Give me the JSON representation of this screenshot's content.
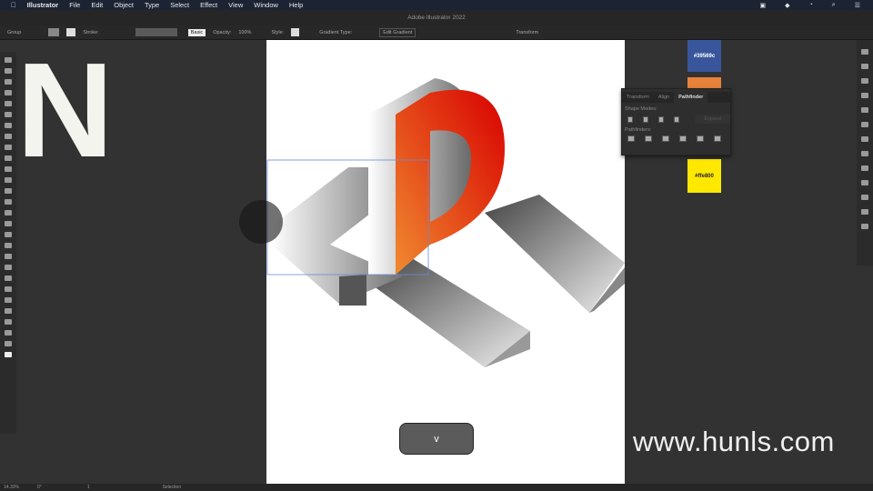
{
  "menubar": {
    "app": "Illustrator",
    "items": [
      "File",
      "Edit",
      "Object",
      "Type",
      "Select",
      "Effect",
      "View",
      "Window",
      "Help"
    ]
  },
  "window_title": "Adobe Illustrator 2022",
  "control": {
    "selection": "Group",
    "stroke_label": "Stroke:",
    "brush": "Basic",
    "opacity_label": "Opacity:",
    "opacity": "100%",
    "style_label": "Style:",
    "gradient_type_label": "Gradient Type:",
    "edit_gradient": "Edit Gradient",
    "transform": "Transform"
  },
  "swatches": [
    {
      "label": "#39569c",
      "color": "#39569c"
    },
    {
      "label": "",
      "color": "#e8823a"
    },
    {
      "label": "#ffe800",
      "color": "#ffe800"
    }
  ],
  "pathfinder": {
    "tabs": [
      "Transform",
      "Align",
      "Pathfinder"
    ],
    "shape_modes": "Shape Modes:",
    "expand": "Expand",
    "pathfinders": "Pathfinders:"
  },
  "canvas": {
    "big_letter": "N"
  },
  "next_button": "v",
  "watermark": "www.hunls.com",
  "status": {
    "zoom": "14.33%",
    "rotate": "0°",
    "page": "1",
    "tool": "Selection"
  }
}
